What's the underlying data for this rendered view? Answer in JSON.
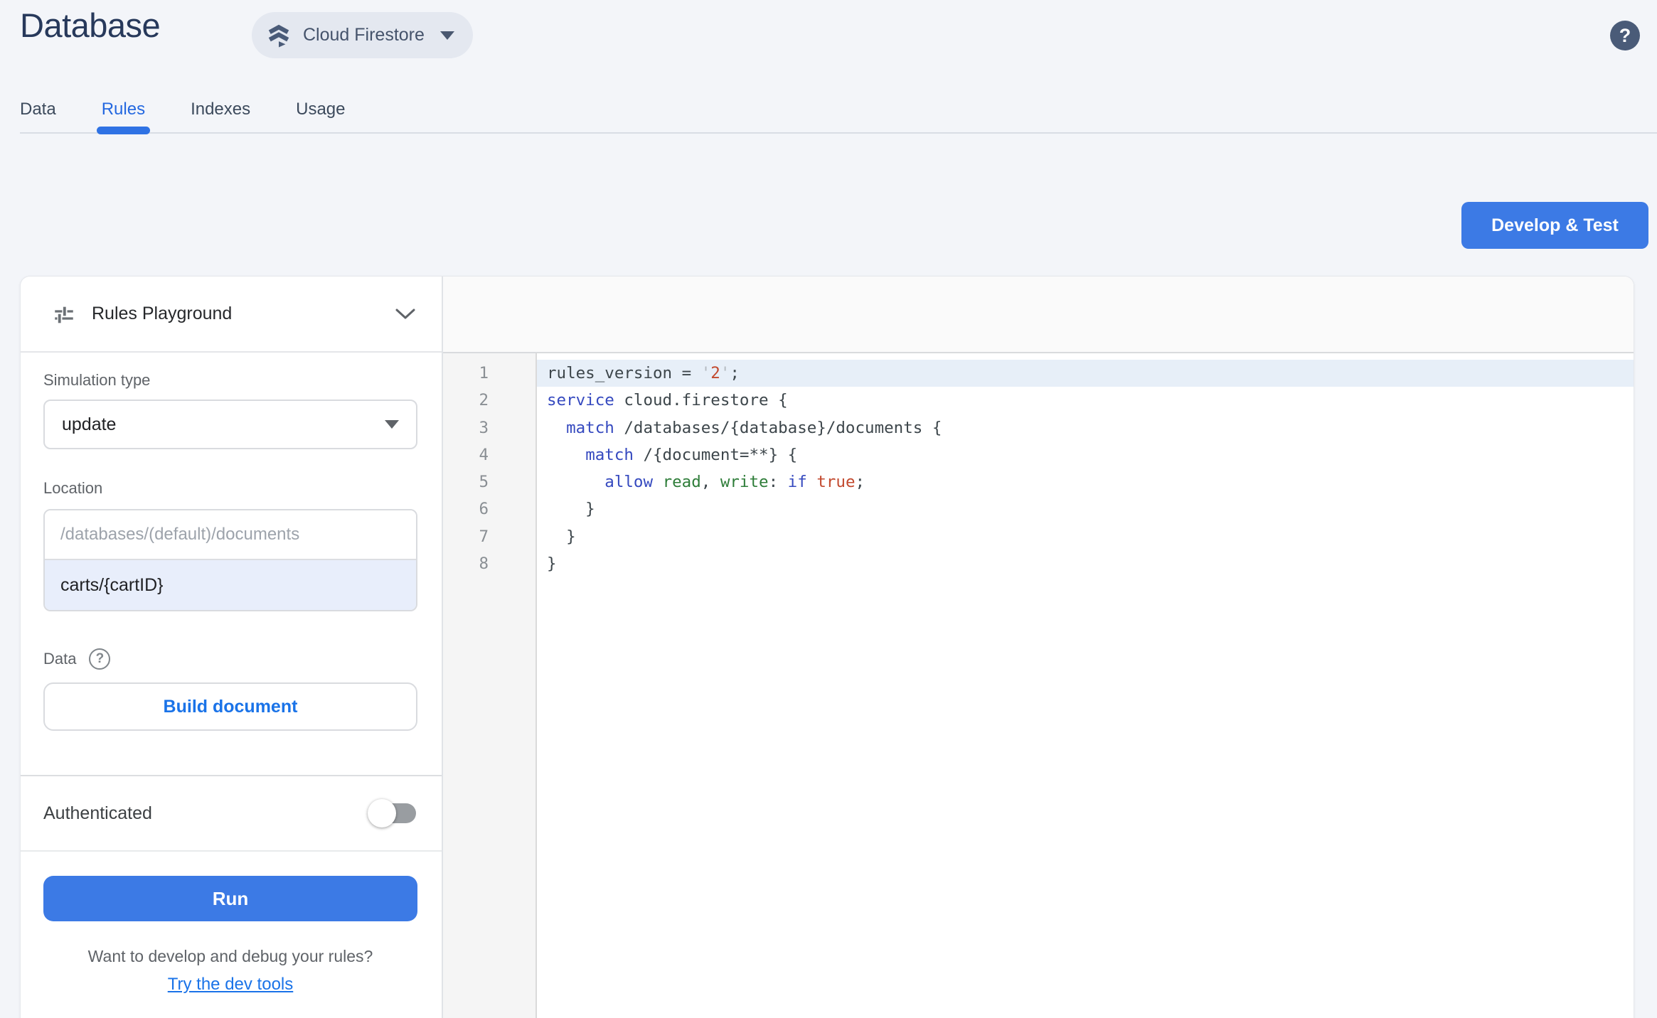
{
  "header": {
    "title": "Database",
    "product_switcher_label": "Cloud Firestore",
    "help_glyph": "?"
  },
  "tabs": [
    {
      "label": "Data",
      "active": false
    },
    {
      "label": "Rules",
      "active": true
    },
    {
      "label": "Indexes",
      "active": false
    },
    {
      "label": "Usage",
      "active": false
    }
  ],
  "actions": {
    "develop_test_label": "Develop & Test"
  },
  "playground": {
    "title": "Rules Playground",
    "simulation_type": {
      "label": "Simulation type",
      "value": "update"
    },
    "location": {
      "label": "Location",
      "prefix_placeholder": "/databases/(default)/documents",
      "value": "carts/{cartID}"
    },
    "data_section": {
      "label": "Data",
      "help_glyph": "?",
      "build_button_label": "Build document"
    },
    "authenticated": {
      "label": "Authenticated",
      "enabled": false
    },
    "run_button_label": "Run",
    "dev_tools": {
      "question": "Want to develop and debug your rules?",
      "link_label": "Try the dev tools"
    }
  },
  "editor": {
    "language": "firestore-security-rules",
    "lines": [
      {
        "num": 1,
        "highlighted": true,
        "tokens": [
          {
            "c": "d",
            "t": "rules_version = "
          },
          {
            "c": "q",
            "t": "'"
          },
          {
            "c": "a",
            "t": "2"
          },
          {
            "c": "q",
            "t": "'"
          },
          {
            "c": "d",
            "t": ";"
          }
        ]
      },
      {
        "num": 2,
        "highlighted": false,
        "tokens": [
          {
            "c": "k",
            "t": "service"
          },
          {
            "c": "d",
            "t": " cloud.firestore {"
          }
        ]
      },
      {
        "num": 3,
        "highlighted": false,
        "tokens": [
          {
            "c": "d",
            "t": "  "
          },
          {
            "c": "k",
            "t": "match"
          },
          {
            "c": "d",
            "t": " /databases/{database}/documents {"
          }
        ]
      },
      {
        "num": 4,
        "highlighted": false,
        "tokens": [
          {
            "c": "d",
            "t": "    "
          },
          {
            "c": "k",
            "t": "match"
          },
          {
            "c": "d",
            "t": " /{document=**} {"
          }
        ]
      },
      {
        "num": 5,
        "highlighted": false,
        "tokens": [
          {
            "c": "d",
            "t": "      "
          },
          {
            "c": "k",
            "t": "allow"
          },
          {
            "c": "d",
            "t": " "
          },
          {
            "c": "g",
            "t": "read"
          },
          {
            "c": "d",
            "t": ", "
          },
          {
            "c": "g",
            "t": "write"
          },
          {
            "c": "d",
            "t": ": "
          },
          {
            "c": "k",
            "t": "if"
          },
          {
            "c": "d",
            "t": " "
          },
          {
            "c": "a",
            "t": "true"
          },
          {
            "c": "d",
            "t": ";"
          }
        ]
      },
      {
        "num": 6,
        "highlighted": false,
        "tokens": [
          {
            "c": "d",
            "t": "    }"
          }
        ]
      },
      {
        "num": 7,
        "highlighted": false,
        "tokens": [
          {
            "c": "d",
            "t": "  }"
          }
        ]
      },
      {
        "num": 8,
        "highlighted": false,
        "tokens": [
          {
            "c": "d",
            "t": "}"
          }
        ]
      }
    ]
  },
  "colors": {
    "accent_blue": "#1a73e8",
    "button_blue": "#3c7ae5",
    "active_tab_blue": "#2468e0",
    "keyword": "#3549bf",
    "identifier_green": "#2e7d39",
    "atom_red": "#c2492e",
    "quote_gray": "#b4bac0",
    "line_highlight": "#e7eff8",
    "title_navy": "#27395b"
  }
}
